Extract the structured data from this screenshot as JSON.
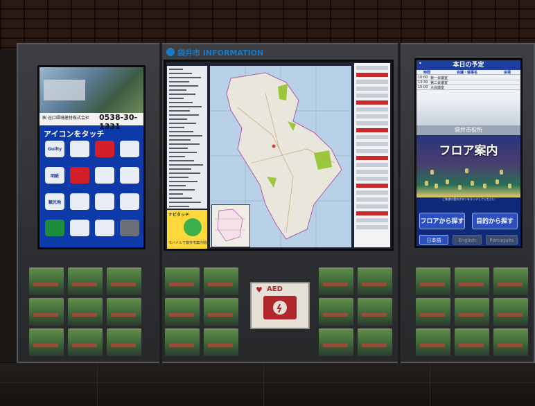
{
  "left_screen": {
    "company": "㈱ 谷口環境建材株式会社",
    "phone": "0538-30-1331",
    "touch_title": "アイコンをタッチ",
    "icons": [
      {
        "label": "Guilty",
        "style": ""
      },
      {
        "label": "",
        "style": ""
      },
      {
        "label": "",
        "style": "red"
      },
      {
        "label": "",
        "style": ""
      },
      {
        "label": "明紙",
        "style": ""
      },
      {
        "label": "",
        "style": "red"
      },
      {
        "label": "",
        "style": ""
      },
      {
        "label": "",
        "style": ""
      },
      {
        "label": "観光地",
        "style": ""
      },
      {
        "label": "",
        "style": ""
      },
      {
        "label": "",
        "style": ""
      },
      {
        "label": "",
        "style": ""
      },
      {
        "label": "",
        "style": "green"
      },
      {
        "label": "",
        "style": ""
      },
      {
        "label": "",
        "style": ""
      },
      {
        "label": "",
        "style": "gray"
      }
    ]
  },
  "center_screen": {
    "header": "袋井市 INFORMATION",
    "navi_title": "ナビタッチ",
    "navi_caption": "モバイルで袋井市案内情報"
  },
  "right_screen": {
    "title": "本日の予定",
    "table_headers": [
      "時間",
      "会議・催事名",
      "会場"
    ],
    "rows": [
      {
        "time": "10:00",
        "room": "第一会議室"
      },
      {
        "time": "13:30",
        "room": "第二会議室"
      },
      {
        "time": "15:00",
        "room": "大会議室"
      }
    ],
    "office_name": "袋井市役所",
    "floor_guide": "フロア案内",
    "touch_hint": "ご希望の案内ボタンをタッチしてください",
    "btn_floor": "フロアから探す",
    "btn_purpose": "目的から探す",
    "lang_jp": "日本語",
    "lang_en": "English",
    "lang_pt": "Português"
  },
  "aed": {
    "label": "AED"
  },
  "colors": {
    "accent": "#2c4fc0",
    "aed_red": "#b0262b",
    "info_header": "#1a7ac8"
  }
}
